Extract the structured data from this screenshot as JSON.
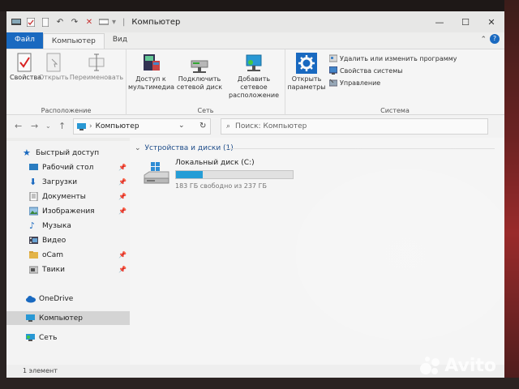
{
  "window": {
    "title": "Компьютер",
    "minimize": "—",
    "maximize": "☐",
    "close": "✕"
  },
  "tabs": {
    "file": "Файл",
    "computer": "Компьютер",
    "view": "Вид"
  },
  "ribbon": {
    "groups": {
      "location": "Расположение",
      "network": "Сеть",
      "system": "Система"
    },
    "location": {
      "properties": "Свойства",
      "open": "Открыть",
      "rename": "Переименовать"
    },
    "network": {
      "media_access": "Доступ к мультимедиа",
      "map_drive": "Подключить сетевой диск",
      "add_location": "Добавить сетевое расположение"
    },
    "system": {
      "open_settings": "Открыть параметры",
      "uninstall": "Удалить или изменить программу",
      "system_properties": "Свойства системы",
      "manage": "Управление"
    }
  },
  "address": {
    "path": "Компьютер",
    "search_placeholder": "Поиск: Компьютер"
  },
  "sidebar": {
    "quick_access": "Быстрый доступ",
    "items": [
      {
        "label": "Рабочий стол",
        "icon": "desktop-icon"
      },
      {
        "label": "Загрузки",
        "icon": "downloads-icon"
      },
      {
        "label": "Документы",
        "icon": "documents-icon"
      },
      {
        "label": "Изображения",
        "icon": "pictures-icon"
      },
      {
        "label": "Музыка",
        "icon": "music-icon"
      },
      {
        "label": "Видео",
        "icon": "video-icon"
      },
      {
        "label": "oCam",
        "icon": "folder-icon"
      },
      {
        "label": "Твики",
        "icon": "folder-icon"
      }
    ],
    "onedrive": "OneDrive",
    "computer": "Компьютер",
    "network": "Сеть"
  },
  "content": {
    "group_header": "Устройства и диски (1)",
    "drive": {
      "name": "Локальный диск (C:)",
      "free_text": "183 ГБ свободно из 237 ГБ",
      "used_fraction": 0.228
    }
  },
  "status": {
    "items_count": "1 элемент"
  },
  "watermark": "Avito",
  "colors": {
    "accent": "#1a6bc4",
    "drive_fill": "#26a0da",
    "folder": "#e8b84a"
  }
}
